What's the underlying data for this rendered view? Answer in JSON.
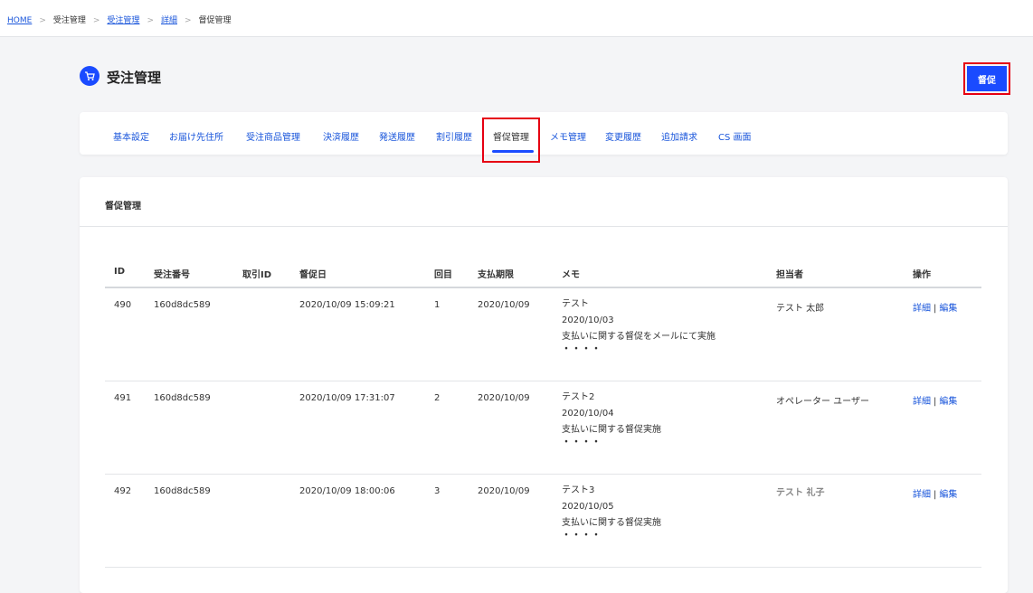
{
  "breadcrumb": {
    "home": "HOME",
    "item1": "受注管理",
    "item2": "受注管理",
    "item3": "詳細",
    "current": "督促管理",
    "separator": ">"
  },
  "header": {
    "title": "受注管理",
    "icon": "cart-icon",
    "action_label": "督促"
  },
  "tabs": [
    {
      "label": "基本設定"
    },
    {
      "label": "お届け先住所"
    },
    {
      "label": "受注商品管理"
    },
    {
      "label": "決済履歴"
    },
    {
      "label": "発送履歴"
    },
    {
      "label": "割引履歴"
    },
    {
      "label": "督促管理",
      "active": true
    },
    {
      "label": "メモ管理"
    },
    {
      "label": "変更履歴"
    },
    {
      "label": "追加請求"
    },
    {
      "label": "CS 画面"
    }
  ],
  "section": {
    "title": "督促管理"
  },
  "table": {
    "columns": [
      "ID",
      "受注番号",
      "取引ID",
      "督促日",
      "回目",
      "支払期限",
      "メモ",
      "担当者",
      "操作"
    ],
    "detail_label": "詳細",
    "edit_label": "編集",
    "op_separator": "|",
    "rows": [
      {
        "id": "490",
        "order_no": "160d8dc589",
        "txn_id": "",
        "date": "2020/10/09 15:09:21",
        "count": "1",
        "due": "2020/10/09",
        "memo": [
          "テスト",
          "2020/10/03",
          "支払いに関する督促をメールにて実施",
          "・・・・"
        ],
        "staff": "テスト 太郎"
      },
      {
        "id": "491",
        "order_no": "160d8dc589",
        "txn_id": "",
        "date": "2020/10/09 17:31:07",
        "count": "2",
        "due": "2020/10/09",
        "memo": [
          "テスト2",
          "2020/10/04",
          "支払いに関する督促実施",
          "・・・・"
        ],
        "staff": "オペレーター ユーザー"
      },
      {
        "id": "492",
        "order_no": "160d8dc589",
        "txn_id": "",
        "date": "2020/10/09 18:00:06",
        "count": "3",
        "due": "2020/10/09",
        "memo": [
          "テスト3",
          "2020/10/05",
          "支払いに関する督促実施",
          "・・・・"
        ],
        "staff": "テスト 礼子"
      }
    ]
  },
  "colors": {
    "accent": "#1a4bff",
    "link": "#1a56db",
    "highlight": "#e60012"
  }
}
